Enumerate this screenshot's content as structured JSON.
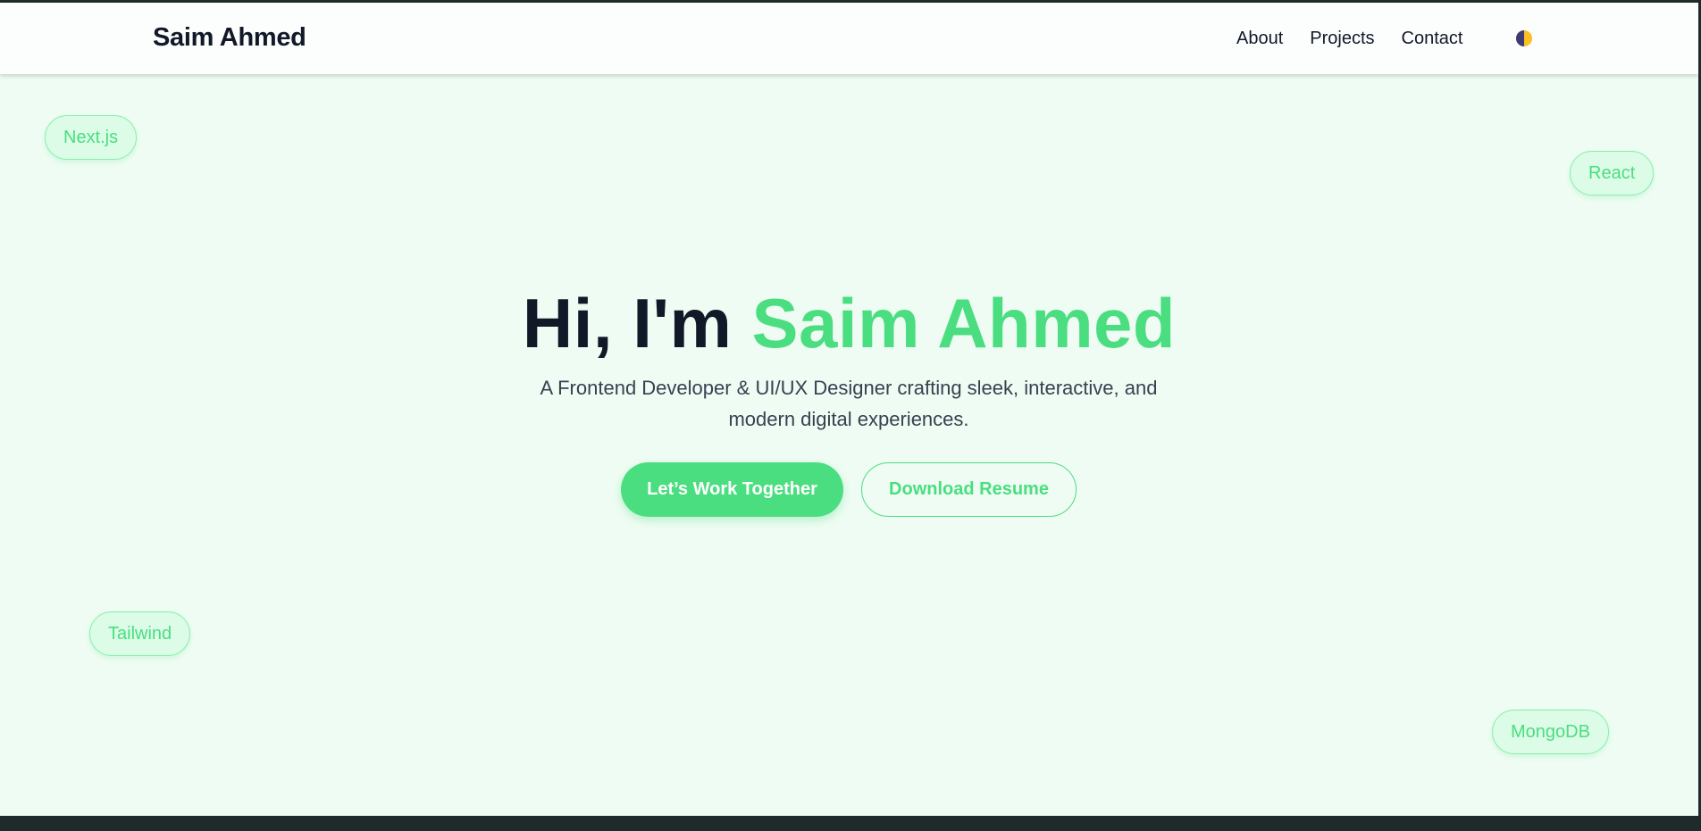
{
  "header": {
    "brand": "Saim Ahmed",
    "nav": [
      "About",
      "Projects",
      "Contact"
    ],
    "theme_toggle_icon": "theme-toggle-icon"
  },
  "chips": [
    "Next.js",
    "React",
    "Tailwind",
    "MongoDB"
  ],
  "hero": {
    "title_prefix": "Hi, I'm",
    "title_name": "Saim Ahmed",
    "subtitle": "A Frontend Developer & UI/UX Designer crafting sleek, interactive, and modern digital experiences.",
    "primary_button": "Let’s Work Together",
    "secondary_button": "Download Resume"
  },
  "colors": {
    "accent": "#4ade80",
    "background": "#effcf3",
    "text_dark": "#111827"
  }
}
